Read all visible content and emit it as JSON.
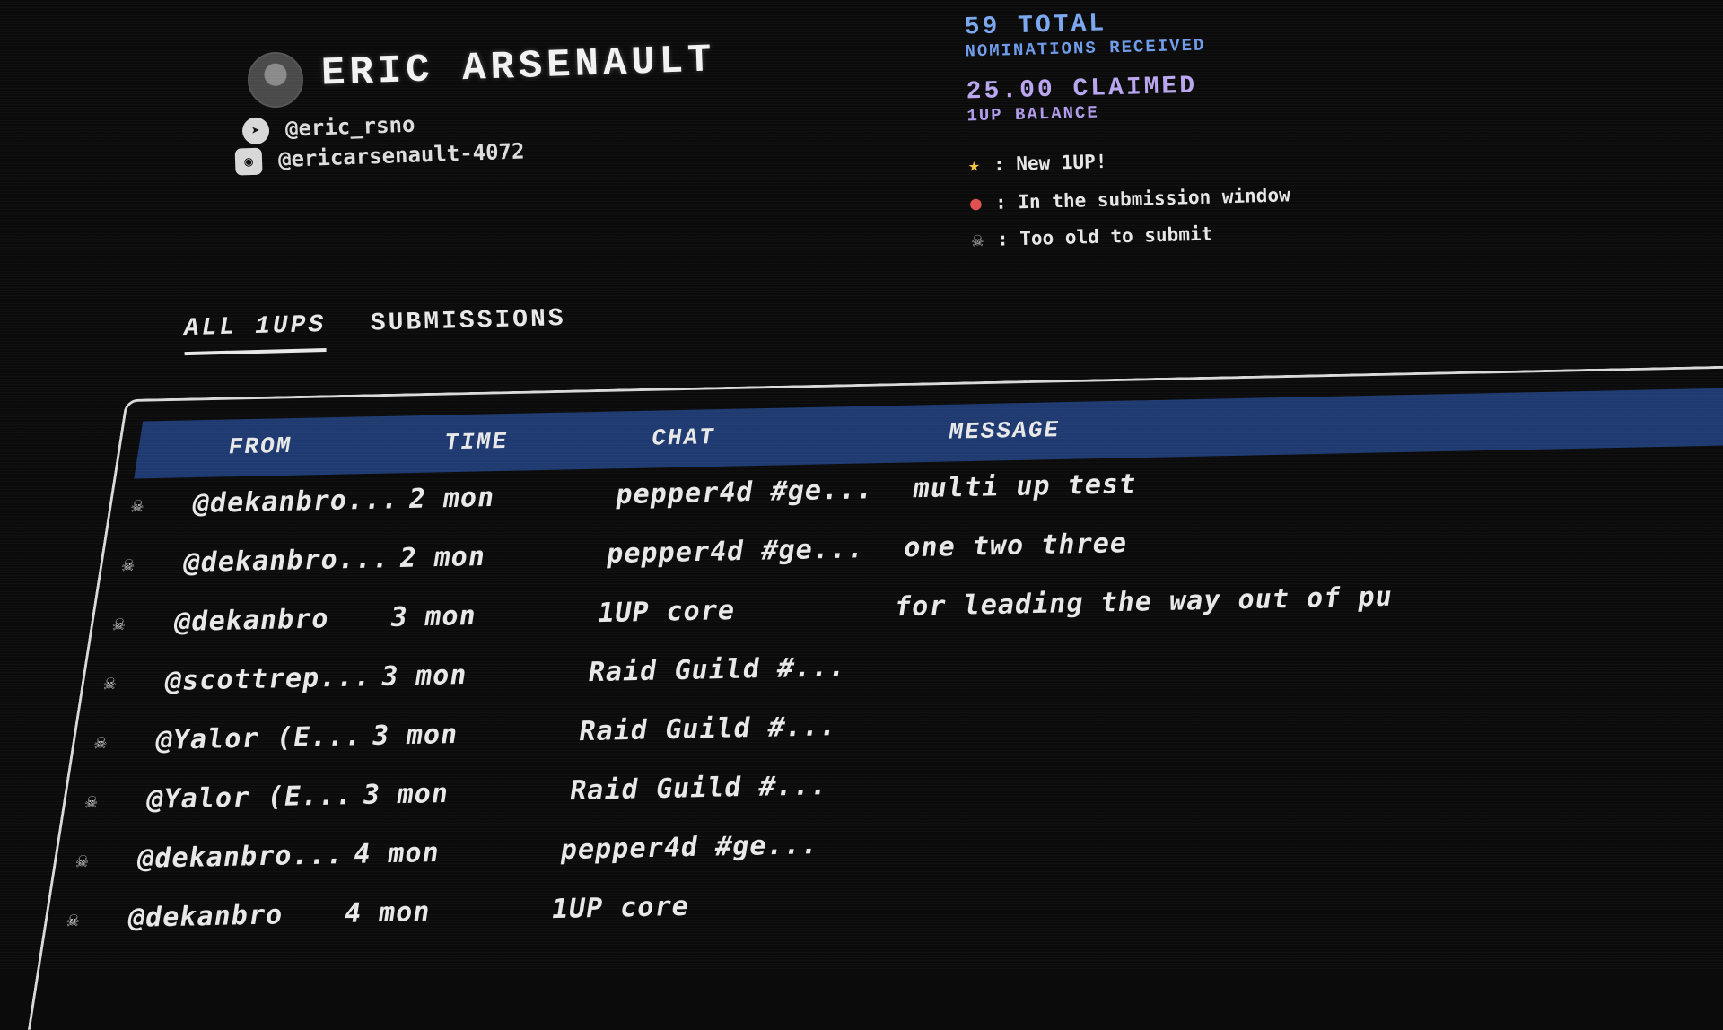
{
  "profile": {
    "name": "ERIC ARSENAULT",
    "telegram": "@eric_rsno",
    "discord": "@ericarsenault-4072"
  },
  "stats": {
    "total_value": "59 TOTAL",
    "total_label": "NOMINATIONS RECEIVED",
    "claimed_value": "25.00 CLAIMED",
    "claimed_label": "1UP BALANCE"
  },
  "legend": [
    {
      "icon": "star-icon",
      "text": ": New 1UP!"
    },
    {
      "icon": "mushroom-icon",
      "text": ": In the submission window"
    },
    {
      "icon": "skull-icon",
      "text": ": Too old to submit"
    }
  ],
  "tabs": [
    {
      "label": "ALL 1UPS",
      "active": true
    },
    {
      "label": "SUBMISSIONS",
      "active": false
    }
  ],
  "table": {
    "headers": {
      "from": "FROM",
      "time": "TIME",
      "chat": "CHAT",
      "message": "MESSAGE"
    },
    "rows": [
      {
        "icon": "skull-icon",
        "from": "@dekanbro...",
        "time": "2 mon",
        "chat": "pepper4d #ge...",
        "message": "multi up test"
      },
      {
        "icon": "skull-icon",
        "from": "@dekanbro...",
        "time": "2 mon",
        "chat": "pepper4d #ge...",
        "message": "one two three"
      },
      {
        "icon": "skull-icon",
        "from": "@dekanbro",
        "time": "3 mon",
        "chat": "1UP core",
        "message": "for leading the way out of pu"
      },
      {
        "icon": "skull-icon",
        "from": "@scottrep...",
        "time": "3 mon",
        "chat": "Raid Guild #...",
        "message": ""
      },
      {
        "icon": "skull-icon",
        "from": "@Yalor (E...",
        "time": "3 mon",
        "chat": "Raid Guild #...",
        "message": ""
      },
      {
        "icon": "skull-icon",
        "from": "@Yalor (E...",
        "time": "3 mon",
        "chat": "Raid Guild #...",
        "message": ""
      },
      {
        "icon": "skull-icon",
        "from": "@dekanbro...",
        "time": "4 mon",
        "chat": "pepper4d #ge...",
        "message": ""
      },
      {
        "icon": "skull-icon",
        "from": "@dekanbro",
        "time": "4 mon",
        "chat": "1UP core",
        "message": ""
      }
    ]
  },
  "colors": {
    "background": "#0b0b0b",
    "header_blue": "#1e3a70",
    "total_blue": "#7aa7f0",
    "claimed_purple": "#b9a6ef"
  }
}
